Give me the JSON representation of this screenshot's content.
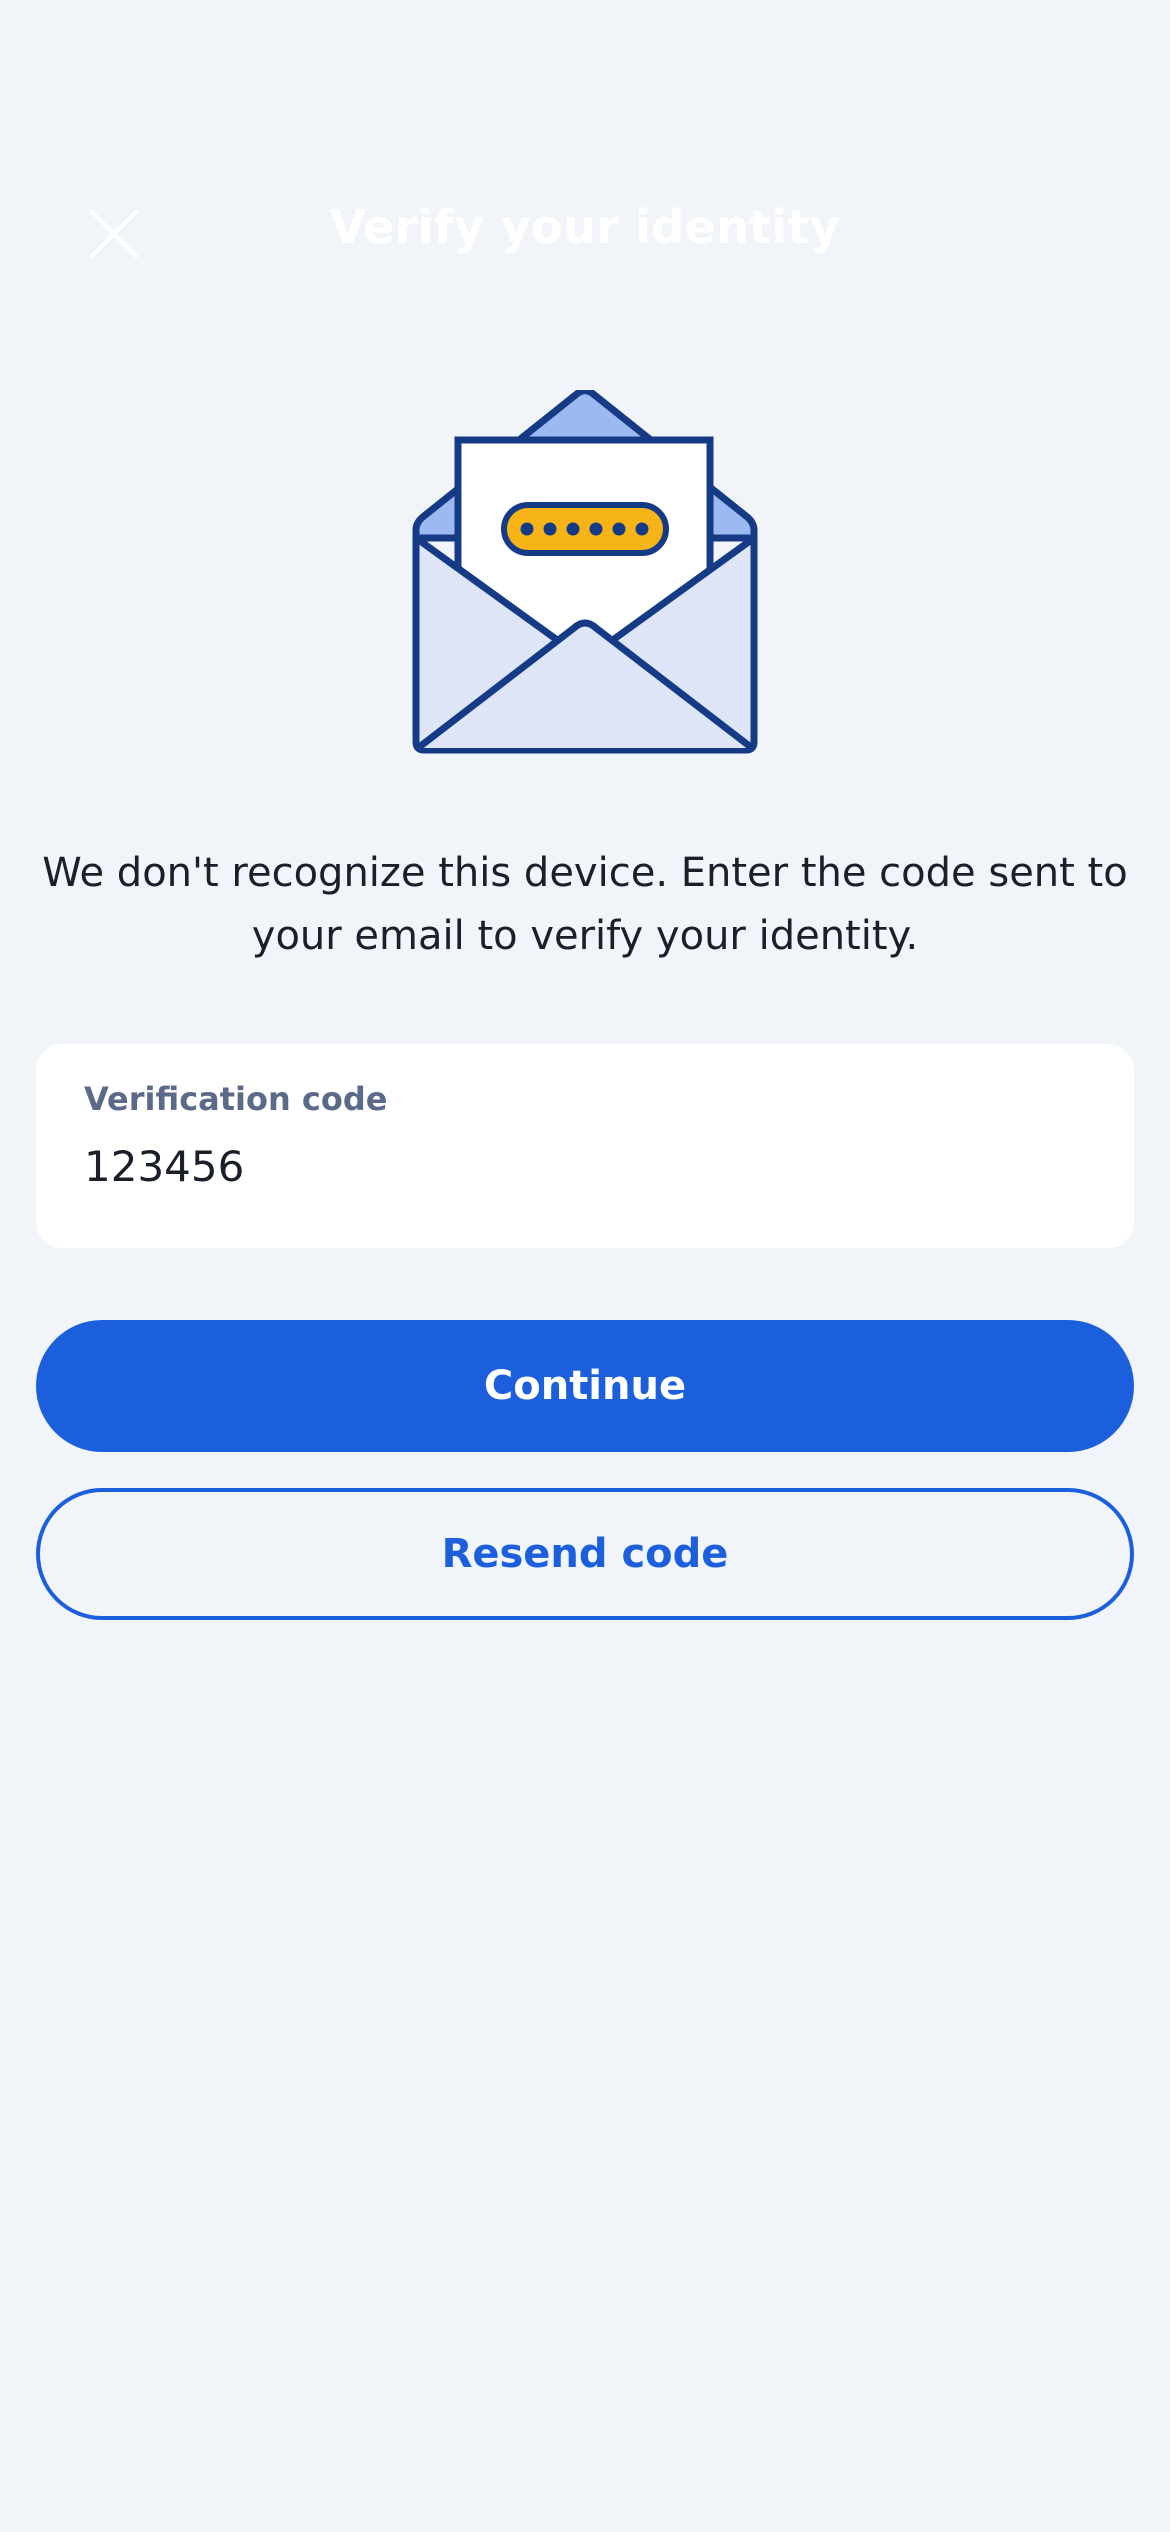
{
  "header": {
    "title": "Verify your identity",
    "close_icon": "close-icon"
  },
  "illustration": {
    "icon": "envelope-code-icon",
    "colors": {
      "outline": "#163b86",
      "envelope": "#dde5f7",
      "flap": "#9cb9f1",
      "letter": "#ffffff",
      "code_pill": "#f6b416"
    }
  },
  "message": "We don't recognize this device. Enter the code sent to your email to verify your identity.",
  "form": {
    "code_label": "Verification code",
    "code_value": "123456"
  },
  "actions": {
    "continue_label": "Continue",
    "resend_label": "Resend code"
  },
  "colors": {
    "background": "#f1f4f8",
    "accent": "#1b5fdc",
    "label": "#5a6a88",
    "text": "#1b1f2a"
  }
}
